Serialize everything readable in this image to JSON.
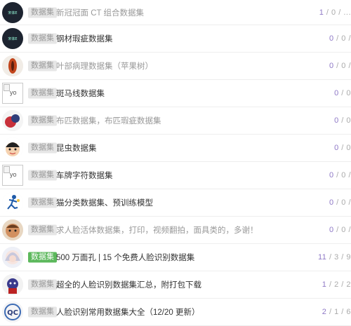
{
  "rows": [
    {
      "tag": "数据集",
      "title": "新冠冠面 CT 组合数据集",
      "views": "1",
      "sep1": "/",
      "replies": "0",
      "sep2": "/",
      "extra": "...",
      "avatar_text": "宋体E",
      "style": "light",
      "tag_style": "gray",
      "avatar": "dark"
    },
    {
      "tag": "数据集",
      "title": "钢材瑕疵数据集",
      "views": "0",
      "sep1": "/",
      "replies": "0",
      "sep2": "/",
      "extra": "",
      "avatar_text": "宋体E",
      "style": "dark",
      "tag_style": "gray",
      "avatar": "dark"
    },
    {
      "tag": "数据集",
      "title": "叶部病理数据集（苹果树）",
      "views": "0",
      "sep1": "/",
      "replies": "0",
      "sep2": "/",
      "extra": "",
      "avatar_text": "",
      "style": "light",
      "tag_style": "gray",
      "avatar": "leaf"
    },
    {
      "tag": "数据集",
      "title": "斑马线数据集",
      "views": "0",
      "sep1": "/",
      "replies": "0",
      "sep2": "",
      "extra": "",
      "avatar_text": "yo",
      "style": "dark",
      "tag_style": "gray",
      "avatar": "broken"
    },
    {
      "tag": "数据集",
      "title": "布匹数据集，布匹瑕疵数据集",
      "views": "0",
      "sep1": "/",
      "replies": "0",
      "sep2": "",
      "extra": "",
      "avatar_text": "",
      "style": "light",
      "tag_style": "gray",
      "avatar": "cloth"
    },
    {
      "tag": "数据集",
      "title": "昆虫数据集",
      "views": "0",
      "sep1": "/",
      "replies": "0",
      "sep2": "",
      "extra": "",
      "avatar_text": "",
      "style": "dark",
      "tag_style": "gray",
      "avatar": "boy"
    },
    {
      "tag": "数据集",
      "title": "车牌字符数据集",
      "views": "0",
      "sep1": "/",
      "replies": "0",
      "sep2": "/",
      "extra": "",
      "avatar_text": "yo",
      "style": "dark",
      "tag_style": "gray",
      "avatar": "broken"
    },
    {
      "tag": "数据集",
      "title": "猫分类数据集、预训练模型",
      "views": "0",
      "sep1": "/",
      "replies": "0",
      "sep2": "/",
      "extra": "",
      "avatar_text": "",
      "style": "dark",
      "tag_style": "gray",
      "avatar": "runner"
    },
    {
      "tag": "数据集",
      "title": "求人脸活体数据集，打印，视频翻拍，面具类的，多谢！",
      "views": "0",
      "sep1": "/",
      "replies": "0",
      "sep2": "/",
      "extra": "",
      "avatar_text": "",
      "style": "light",
      "tag_style": "gray",
      "avatar": "face"
    },
    {
      "tag": "数据集",
      "title": "500 万面孔 | 15 个免费人脸识别数据集",
      "views": "11",
      "sep1": "/",
      "replies": "3",
      "sep2": "/",
      "extra": "9",
      "avatar_text": "",
      "style": "dark",
      "tag_style": "green",
      "avatar": "girl"
    },
    {
      "tag": "数据集",
      "title": "超全的人脸识别数据集汇总，附打包下载",
      "views": "1",
      "sep1": "/",
      "replies": "2",
      "sep2": "/",
      "extra": "2",
      "avatar_text": "",
      "style": "dark",
      "tag_style": "gray",
      "avatar": "robot"
    },
    {
      "tag": "数据集",
      "title": "人脸识别常用数据集大全（12/20 更新）",
      "views": "2",
      "sep1": "/",
      "replies": "1",
      "sep2": "/",
      "extra": "6",
      "avatar_text": "",
      "style": "dark",
      "tag_style": "gray",
      "avatar": "qc"
    }
  ]
}
